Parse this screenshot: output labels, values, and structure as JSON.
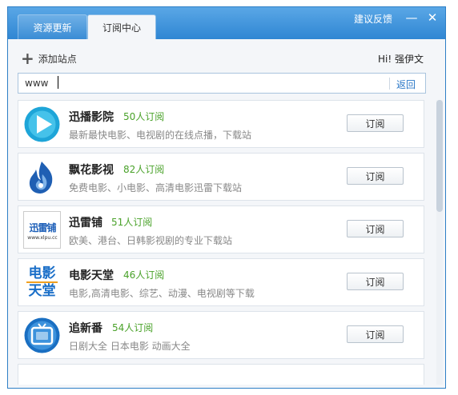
{
  "tabs": [
    {
      "label": "资源更新"
    },
    {
      "label": "订阅中心"
    }
  ],
  "header": {
    "feedback": "建议反馈",
    "minimize": "—",
    "close": "✕"
  },
  "toolbar": {
    "add_label": "添加站点",
    "greeting": "Hi! 强伊文"
  },
  "search": {
    "value": "www",
    "back_label": "返回"
  },
  "sites": [
    {
      "name": "迅播影院",
      "count": "50人订阅",
      "desc": "最新最快电影、电视剧的在线点播，下载站",
      "button": "订阅",
      "icon": "play-icon"
    },
    {
      "name": "飘花影视",
      "count": "82人订阅",
      "desc": "免费电影、小电影、高清电影迅雷下载站",
      "button": "订阅",
      "icon": "flame-icon"
    },
    {
      "name": "迅雷铺",
      "count": "51人订阅",
      "desc": "欧美、港台、日韩影视剧的专业下载站",
      "button": "订阅",
      "icon": "xunleipu-logo",
      "logo_text": "迅雷铺",
      "logo_url": "www.xlpu.cc"
    },
    {
      "name": "电影天堂",
      "count": "46人订阅",
      "desc": "电影,高清电影、综艺、动漫、电视剧等下载",
      "button": "订阅",
      "icon": "dytt-logo",
      "logo_top": "电影",
      "logo_bottom": "天堂"
    },
    {
      "name": "追新番",
      "count": "54人订阅",
      "desc": "日剧大全 日本电影 动画大全",
      "button": "订阅",
      "icon": "tv-icon"
    }
  ],
  "colors": {
    "accent": "#2f86d3",
    "count_green": "#4aa22a",
    "link_blue": "#2b78c7"
  }
}
